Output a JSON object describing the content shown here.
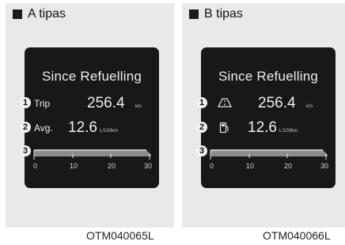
{
  "panels": [
    {
      "header": "A tipas",
      "screen": {
        "title": "Since Refuelling",
        "row1": {
          "badge": "1",
          "label": "Trip",
          "value": "256.4",
          "unit": "km"
        },
        "row2": {
          "badge": "2",
          "label": "Avg.",
          "value": "12.6",
          "unit": "L/100km"
        },
        "gauge": {
          "badge": "3",
          "ticks": [
            "0",
            "10",
            "20",
            "30"
          ]
        }
      },
      "caption": "OTM040065L"
    },
    {
      "header": "B tipas",
      "screen": {
        "title": "Since Refuelling",
        "row1": {
          "badge": "1",
          "icon": "road-icon",
          "value": "256.4",
          "unit": "km"
        },
        "row2": {
          "badge": "2",
          "icon": "fuel-pump-icon",
          "value": "12.6",
          "unit": "L/100km"
        },
        "gauge": {
          "badge": "3",
          "ticks": [
            "0",
            "10",
            "20",
            "30"
          ]
        }
      },
      "caption": "OTM040066L"
    }
  ]
}
